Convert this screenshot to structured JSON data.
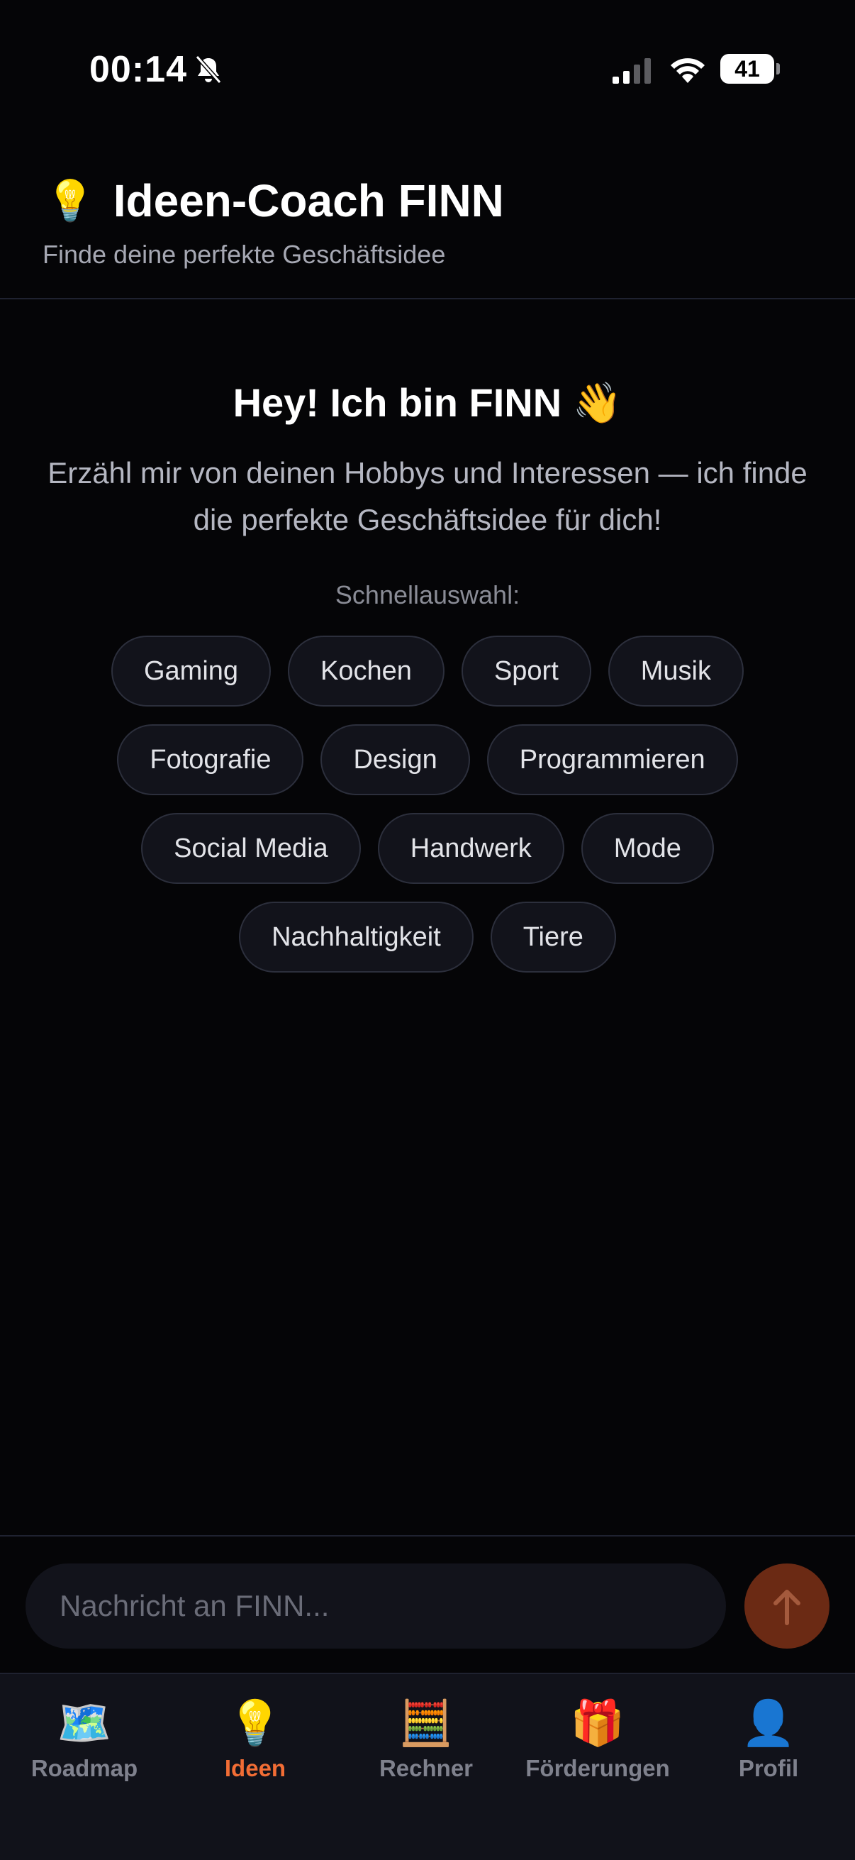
{
  "status_bar": {
    "time": "00:14",
    "battery": "41",
    "icons": [
      "bell-slash-icon",
      "signal-icon",
      "wifi-icon",
      "battery-icon"
    ]
  },
  "header": {
    "icon": "💡",
    "title": "Ideen-Coach FINN",
    "subtitle": "Finde deine perfekte Geschäftsidee"
  },
  "welcome": {
    "title": "Hey! Ich bin FINN 👋",
    "text": "Erzähl mir von deinen Hobbys und Interessen — ich finde die perfekte Geschäftsidee für dich!",
    "quick_label": "Schnellauswahl:"
  },
  "chips": [
    [
      "Gaming",
      "Kochen",
      "Sport",
      "Musik"
    ],
    [
      "Fotografie",
      "Design",
      "Programmieren"
    ],
    [
      "Social Media",
      "Handwerk",
      "Mode"
    ],
    [
      "Nachhaltigkeit",
      "Tiere"
    ]
  ],
  "composer": {
    "placeholder": "Nachricht an FINN...",
    "send_icon": "arrow-up-icon"
  },
  "tabs": [
    {
      "icon": "🗺️",
      "label": "Roadmap",
      "active": false
    },
    {
      "icon": "💡",
      "label": "Ideen",
      "active": true
    },
    {
      "icon": "🧮",
      "label": "Rechner",
      "active": false
    },
    {
      "icon": "🎁",
      "label": "Förderungen",
      "active": false
    },
    {
      "icon": "👤",
      "label": "Profil",
      "active": false
    }
  ],
  "colors": {
    "background": "#050507",
    "accent": "#f26d35",
    "chip_bg": "#12131b",
    "chip_border": "#2c2f3c"
  }
}
